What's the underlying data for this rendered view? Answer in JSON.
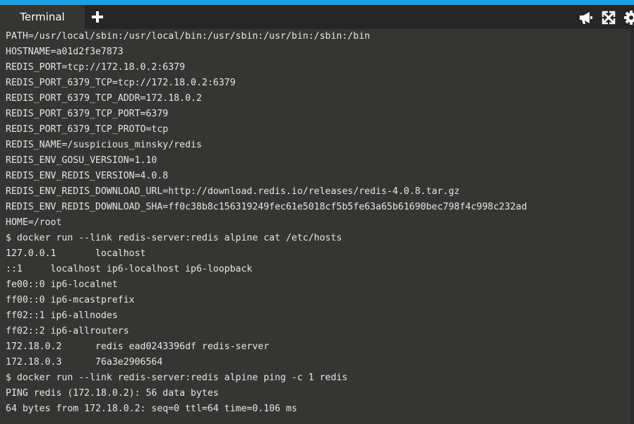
{
  "tabs": [
    {
      "label": "Terminal",
      "active": true
    }
  ],
  "toolbar": {
    "add_tab_icon": "plus-icon",
    "icons": [
      "megaphone-icon",
      "expand-icon",
      "gear-icon"
    ]
  },
  "colors": {
    "accent": "#1aa1e0",
    "tabbar_bg": "#262626",
    "terminal_bg": "#353533",
    "terminal_text": "#e6e6e6"
  },
  "terminal": {
    "lines": [
      "PATH=/usr/local/sbin:/usr/local/bin:/usr/sbin:/usr/bin:/sbin:/bin",
      "HOSTNAME=a01d2f3e7873",
      "REDIS_PORT=tcp://172.18.0.2:6379",
      "REDIS_PORT_6379_TCP=tcp://172.18.0.2:6379",
      "REDIS_PORT_6379_TCP_ADDR=172.18.0.2",
      "REDIS_PORT_6379_TCP_PORT=6379",
      "REDIS_PORT_6379_TCP_PROTO=tcp",
      "REDIS_NAME=/suspicious_minsky/redis",
      "REDIS_ENV_GOSU_VERSION=1.10",
      "REDIS_ENV_REDIS_VERSION=4.0.8",
      "REDIS_ENV_REDIS_DOWNLOAD_URL=http://download.redis.io/releases/redis-4.0.8.tar.gz",
      "REDIS_ENV_REDIS_DOWNLOAD_SHA=ff0c38b8c156319249fec61e5018cf5b5fe63a65b61690bec798f4c998c232ad",
      "HOME=/root",
      "$ docker run --link redis-server:redis alpine cat /etc/hosts",
      "127.0.0.1       localhost",
      "::1     localhost ip6-localhost ip6-loopback",
      "fe00::0 ip6-localnet",
      "ff00::0 ip6-mcastprefix",
      "ff02::1 ip6-allnodes",
      "ff02::2 ip6-allrouters",
      "172.18.0.2      redis ead0243396df redis-server",
      "172.18.0.3      76a3e2906564",
      "$ docker run --link redis-server:redis alpine ping -c 1 redis",
      "PING redis (172.18.0.2): 56 data bytes",
      "64 bytes from 172.18.0.2: seq=0 ttl=64 time=0.106 ms"
    ]
  }
}
